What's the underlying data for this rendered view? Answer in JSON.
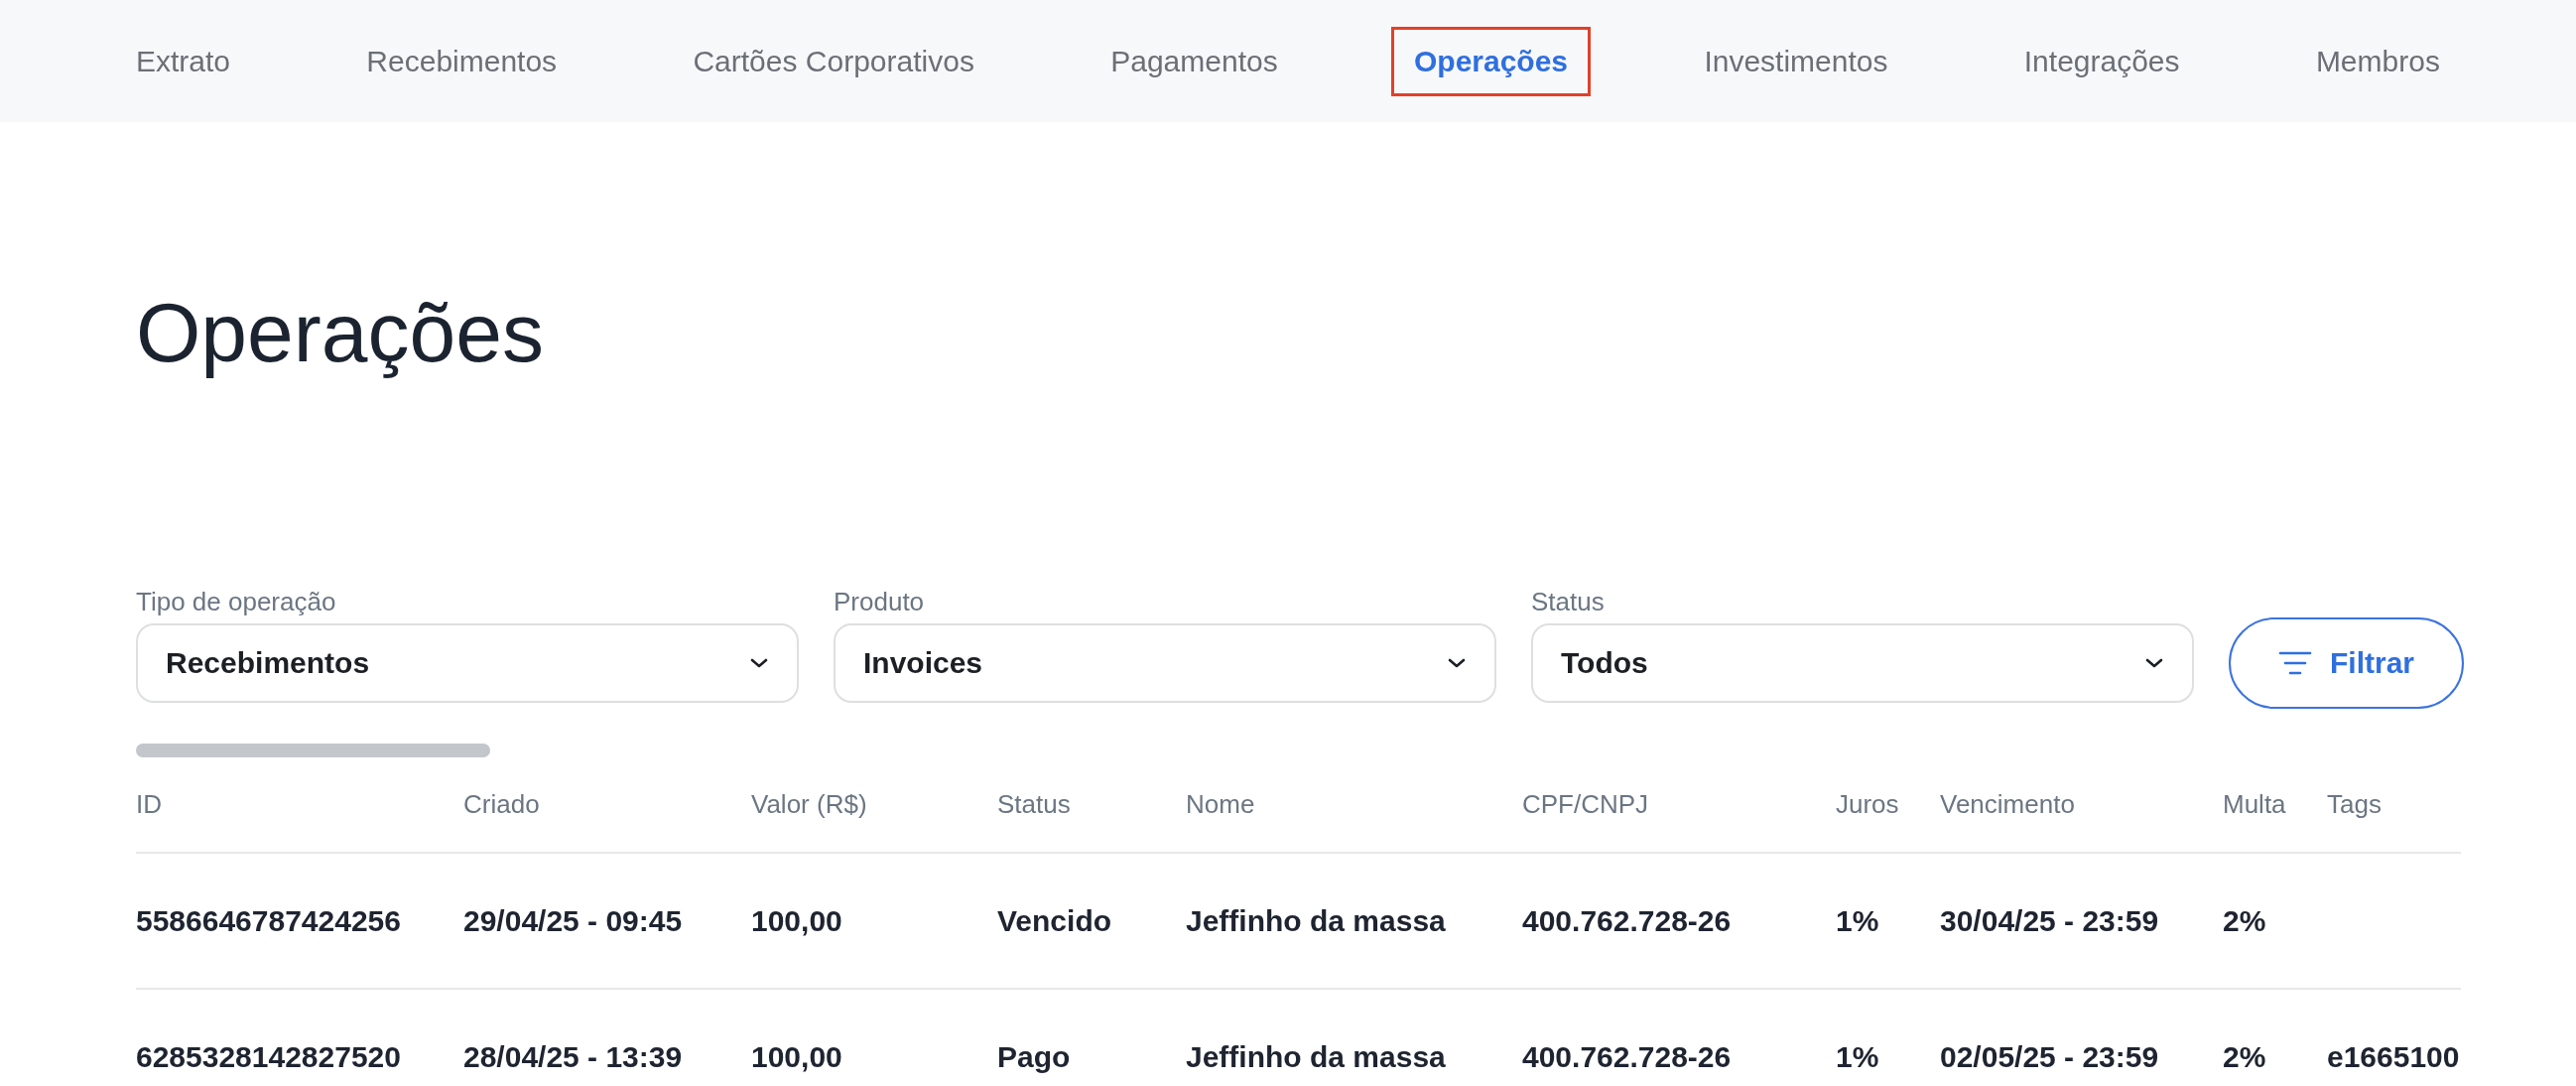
{
  "nav": {
    "tabs": [
      {
        "label": "Extrato",
        "selected": false,
        "highlighted": false
      },
      {
        "label": "Recebimentos",
        "selected": false,
        "highlighted": false
      },
      {
        "label": "Cartões Corporativos",
        "selected": false,
        "highlighted": false
      },
      {
        "label": "Pagamentos",
        "selected": false,
        "highlighted": false
      },
      {
        "label": "Operações",
        "selected": true,
        "highlighted": true
      },
      {
        "label": "Investimentos",
        "selected": false,
        "highlighted": false
      },
      {
        "label": "Integrações",
        "selected": false,
        "highlighted": false
      },
      {
        "label": "Membros",
        "selected": false,
        "highlighted": false
      }
    ]
  },
  "page_title": "Operações",
  "filters": [
    {
      "label": "Tipo de operação",
      "value": "Recebimentos"
    },
    {
      "label": "Produto",
      "value": "Invoices"
    },
    {
      "label": "Status",
      "value": "Todos"
    }
  ],
  "filter_button": {
    "label": "Filtrar"
  },
  "table": {
    "columns": [
      "ID",
      "Criado",
      "Valor (R$)",
      "Status",
      "Nome",
      "CPF/CNPJ",
      "Juros",
      "Vencimento",
      "Multa",
      "Tags"
    ],
    "rows": [
      {
        "cells": [
          "5586646787424256",
          "29/04/25 - 09:45",
          "100,00",
          "Vencido",
          "Jeffinho da massa",
          "400.762.728-26",
          "1%",
          "30/04/25 - 23:59",
          "2%"
        ]
      },
      {
        "cells": [
          "6285328142827520",
          "28/04/25 - 13:39",
          "100,00",
          "Pago",
          "Jeffinho da massa",
          "400.762.728-26",
          "1%",
          "02/05/25 - 23:59",
          "2%",
          "e1665100"
        ]
      }
    ]
  }
}
